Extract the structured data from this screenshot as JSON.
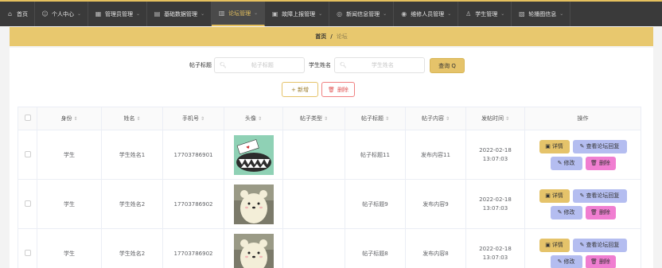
{
  "nav": {
    "items": [
      {
        "label": "首页",
        "icon": "home-icon",
        "caret": false
      },
      {
        "label": "个人中心",
        "icon": "user-icon",
        "caret": true
      },
      {
        "label": "管理员管理",
        "icon": "admin-icon",
        "caret": true
      },
      {
        "label": "基础数据管理",
        "icon": "data-icon",
        "caret": true
      },
      {
        "label": "论坛管理",
        "icon": "forum-icon",
        "caret": true,
        "active": true
      },
      {
        "label": "故障上报管理",
        "icon": "fault-icon",
        "caret": true
      },
      {
        "label": "新闻信息管理",
        "icon": "news-icon",
        "caret": true
      },
      {
        "label": "维修人员管理",
        "icon": "repair-icon",
        "caret": true
      },
      {
        "label": "学生管理",
        "icon": "student-icon",
        "caret": true
      },
      {
        "label": "轮播图信息",
        "icon": "carousel-icon",
        "caret": true
      }
    ],
    "caret_glyph": "⌄"
  },
  "breadcrumb": {
    "home": "首页",
    "separator": "/",
    "current": "论坛"
  },
  "search": {
    "title_label": "帖子标题",
    "title_placeholder": "帖子标题",
    "name_label": "学生姓名",
    "name_placeholder": "学生姓名",
    "query_label": "查询 Q"
  },
  "toolbar": {
    "add_label": "+ 新增",
    "delete_label": "删除"
  },
  "table": {
    "columns": [
      "身份",
      "姓名",
      "手机号",
      "头像",
      "帖子类型",
      "帖子标题",
      "帖子内容",
      "发帖时间",
      "操作"
    ],
    "sortable": [
      true,
      true,
      true,
      true,
      true,
      true,
      true,
      true,
      false
    ],
    "rows": [
      {
        "identity": "学生",
        "name": "学生姓名1",
        "phone": "17703786901",
        "avatar": "monster",
        "type": "",
        "title": "帖子标题11",
        "content": "发布内容11",
        "time": "2022-02-18 13:07:03"
      },
      {
        "identity": "学生",
        "name": "学生姓名2",
        "phone": "17703786902",
        "avatar": "bear",
        "type": "",
        "title": "帖子标题9",
        "content": "发布内容9",
        "time": "2022-02-18 13:07:03"
      },
      {
        "identity": "学生",
        "name": "学生姓名2",
        "phone": "17703786902",
        "avatar": "bear",
        "type": "",
        "title": "帖子标题8",
        "content": "发布内容8",
        "time": "2022-02-18 13:07:03"
      }
    ],
    "ops": {
      "detail": "详情",
      "view": "查看论坛回复",
      "edit": "修改",
      "delete": "删除"
    }
  },
  "colors": {
    "accent": "#e5c36a",
    "nav_bg": "#3a3a3a",
    "view_btn": "#b4bdf0",
    "delete_btn": "#f07ed1"
  }
}
